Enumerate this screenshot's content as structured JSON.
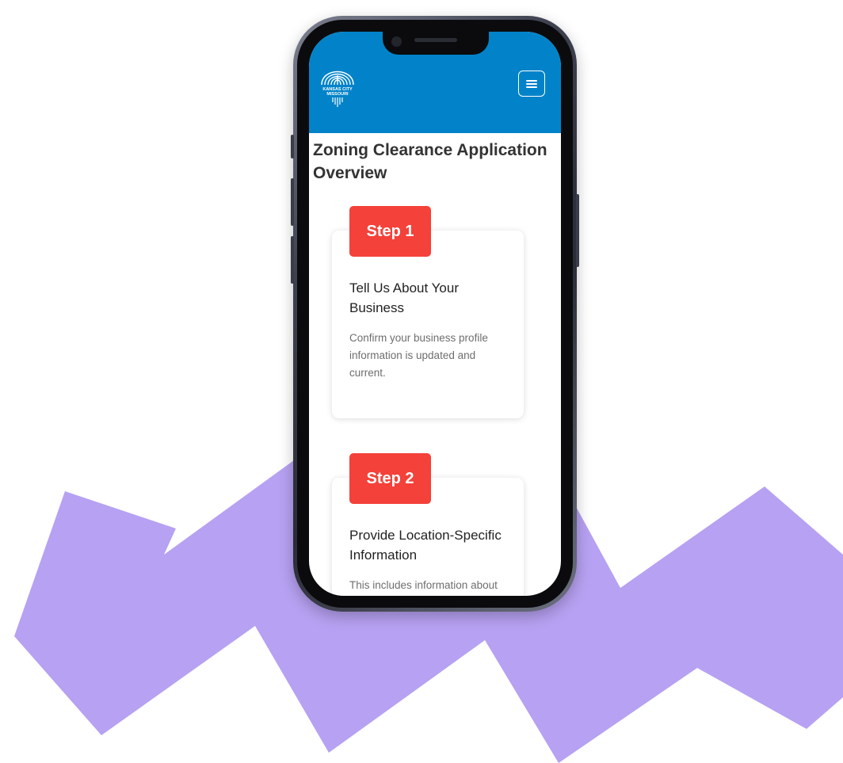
{
  "header": {
    "logo_lines": [
      "KANSAS CITY",
      "MISSOURI"
    ],
    "menu_icon": "hamburger-menu-icon",
    "background_color": "#0283c9"
  },
  "page": {
    "title": "Zoning Clearance Application Overview"
  },
  "steps": [
    {
      "badge": "Step 1",
      "title": "Tell Us About Your Business",
      "description": "Confirm your business profile information is updated and current."
    },
    {
      "badge": "Step 2",
      "title": "Provide Location-Specific Information",
      "description": "This includes information about the business and its"
    }
  ],
  "colors": {
    "step_badge": "#f4413a",
    "decorative_shapes": "#b7a1f2"
  }
}
